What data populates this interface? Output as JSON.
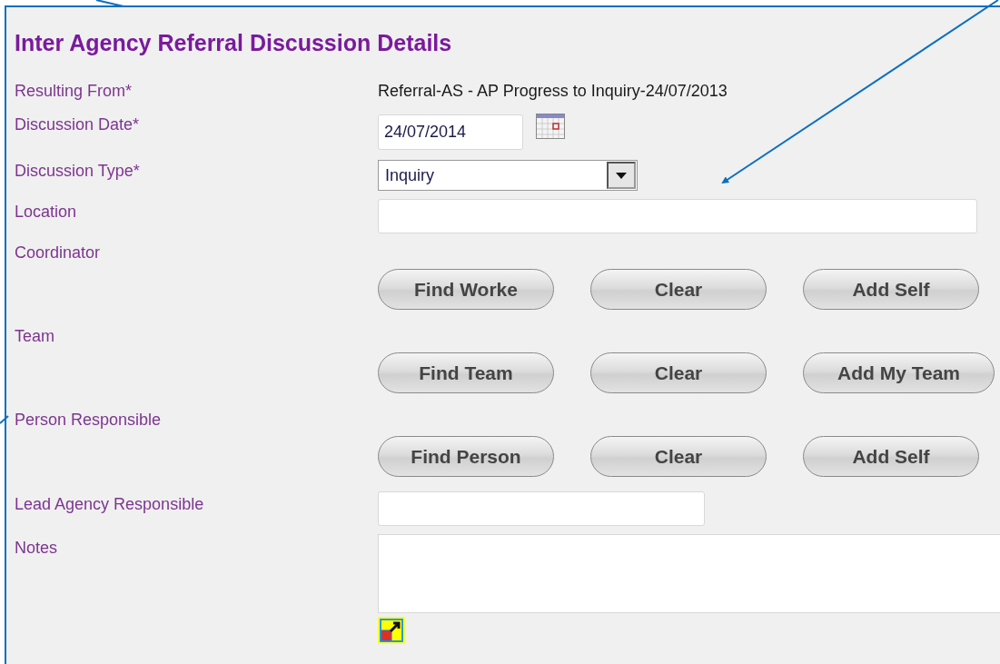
{
  "title": "Inter Agency Referral Discussion Details",
  "fields": [
    {
      "kind": "text",
      "label": "Resulting From*",
      "value": "Referral-AS - AP Progress to Inquiry-24/07/2013"
    },
    {
      "kind": "date",
      "label": "Discussion Date*",
      "value": "24/07/2014"
    },
    {
      "kind": "select",
      "label": "Discussion Type*",
      "value": "Inquiry"
    },
    {
      "kind": "input",
      "label": "Location"
    },
    {
      "kind": "buttons",
      "label": "Coordinator",
      "buttons": [
        "Find Worke",
        "Clear",
        "Add Self"
      ]
    },
    {
      "kind": "buttons",
      "label": "Team",
      "buttons": [
        "Find Team",
        "Clear",
        "Add My Team"
      ]
    },
    {
      "kind": "buttons",
      "label": "Person Responsible",
      "buttons": [
        "Find Person",
        "Clear",
        "Add Self"
      ]
    },
    {
      "kind": "input_short",
      "label": "Lead Agency Responsible"
    },
    {
      "kind": "textarea",
      "label": "Notes"
    }
  ]
}
